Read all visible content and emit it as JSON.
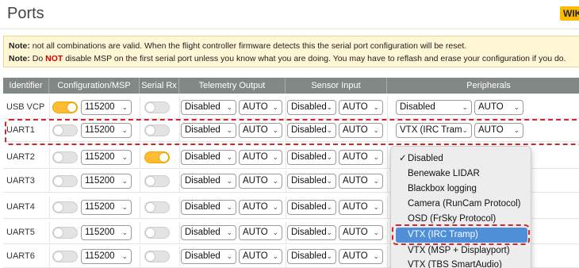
{
  "page": {
    "title": "Ports",
    "wiki_label": "WIKI"
  },
  "notes": {
    "line1_bold": "Note:",
    "line1_text": " not all combinations are valid. When the flight controller firmware detects this the serial port configuration will be reset.",
    "line2_bold": "Note:",
    "line2_pre": " Do ",
    "line2_red": "NOT",
    "line2_post": " disable MSP on the first serial port unless you know what you are doing. You may have to reflash and erase your configuration if you do."
  },
  "table": {
    "headers": [
      "Identifier",
      "Configuration/MSP",
      "Serial Rx",
      "Telemetry Output",
      "Sensor Input",
      "Peripherals"
    ],
    "rows": [
      {
        "id": "USB VCP",
        "msp_on": true,
        "baud": "115200",
        "rx_on": false,
        "tel": "Disabled",
        "tel_baud": "AUTO",
        "sensor": "Disabled",
        "sensor_baud": "AUTO",
        "periph": "Disabled",
        "periph_baud": "AUTO"
      },
      {
        "id": "UART1",
        "msp_on": false,
        "baud": "115200",
        "rx_on": false,
        "tel": "Disabled",
        "tel_baud": "AUTO",
        "sensor": "Disabled",
        "sensor_baud": "AUTO",
        "periph": "VTX (IRC Tram",
        "periph_baud": "AUTO"
      },
      {
        "id": "UART2",
        "msp_on": false,
        "baud": "115200",
        "rx_on": true,
        "tel": "Disabled",
        "tel_baud": "AUTO",
        "sensor": "Disabled",
        "sensor_baud": "AUTO"
      },
      {
        "id": "UART3",
        "msp_on": false,
        "baud": "115200",
        "rx_on": false,
        "tel": "Disabled",
        "tel_baud": "AUTO",
        "sensor": "Disabled",
        "sensor_baud": "AUTO"
      },
      {
        "id": "UART4",
        "msp_on": false,
        "baud": "115200",
        "rx_on": false,
        "tel": "Disabled",
        "tel_baud": "AUTO",
        "sensor": "Disabled",
        "sensor_baud": "AUTO"
      },
      {
        "id": "UART5",
        "msp_on": false,
        "baud": "115200",
        "rx_on": false,
        "tel": "Disabled",
        "tel_baud": "AUTO",
        "sensor": "Disabled",
        "sensor_baud": "AUTO"
      },
      {
        "id": "UART6",
        "msp_on": false,
        "baud": "115200",
        "rx_on": false,
        "tel": "Disabled",
        "tel_baud": "AUTO",
        "sensor": "Disabled",
        "sensor_baud": "AUTO"
      }
    ]
  },
  "dropdown": {
    "check_mark": "✓",
    "options": [
      "Disabled",
      "Benewake LIDAR",
      "Blackbox logging",
      "Camera (RunCam Protocol)",
      "OSD (FrSky Protocol)",
      "VTX (IRC Tramp)",
      "VTX (MSP + Displayport)",
      "VTX (TBS SmartAudio)"
    ],
    "checked_index": 0,
    "highlighted_index": 5
  },
  "colors": {
    "accent": "#ffbb00",
    "highlight_dash": "#d2262b",
    "selection": "#4f8fd8"
  }
}
